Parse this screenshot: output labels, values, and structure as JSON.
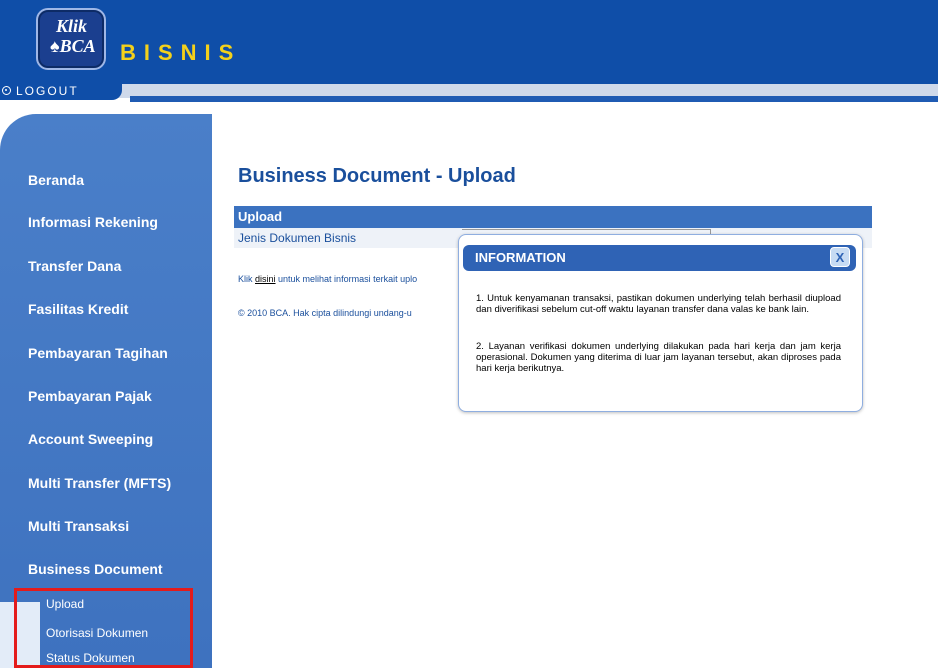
{
  "header": {
    "logo_klik": "Klik",
    "logo_bca": "♠BCA",
    "brand": "BISNIS",
    "logout": "LOGOUT"
  },
  "sidebar": {
    "items": [
      {
        "label": "Beranda"
      },
      {
        "label": "Informasi Rekening"
      },
      {
        "label": "Transfer Dana"
      },
      {
        "label": "Fasilitas Kredit"
      },
      {
        "label": "Pembayaran Tagihan"
      },
      {
        "label": "Pembayaran Pajak"
      },
      {
        "label": "Account Sweeping"
      },
      {
        "label": "Multi Transfer (MFTS)"
      },
      {
        "label": "Multi Transaksi"
      },
      {
        "label": "Business Document"
      }
    ],
    "subitems": [
      {
        "label": "Upload"
      },
      {
        "label": "Otorisasi Dokumen"
      },
      {
        "label": "Status Dokumen"
      }
    ]
  },
  "main": {
    "title": "Business Document - Upload",
    "section_header": "Upload",
    "field_label": "Jenis Dokumen Bisnis",
    "info_prefix": "Klik ",
    "info_link": "disini",
    "info_suffix": " untuk melihat informasi terkait uplo",
    "copyright": "© 2010 BCA. Hak cipta dilindungi undang-u"
  },
  "modal": {
    "title": "INFORMATION",
    "close": "X",
    "p1": "1. Untuk kenyamanan transaksi, pastikan dokumen underlying telah berhasil diupload dan diverifikasi sebelum cut-off waktu layanan transfer dana valas ke bank lain.",
    "p2": "2. Layanan verifikasi dokumen underlying dilakukan pada hari kerja dan jam kerja operasional. Dokumen yang diterima di luar jam layanan tersebut, akan diproses pada hari kerja berikutnya."
  },
  "colors": {
    "header_blue": "#0f4ea8",
    "sidebar_blue": "#4a7fc9",
    "brand_yellow": "#f3d11b",
    "highlight_red": "#e41b1b"
  }
}
